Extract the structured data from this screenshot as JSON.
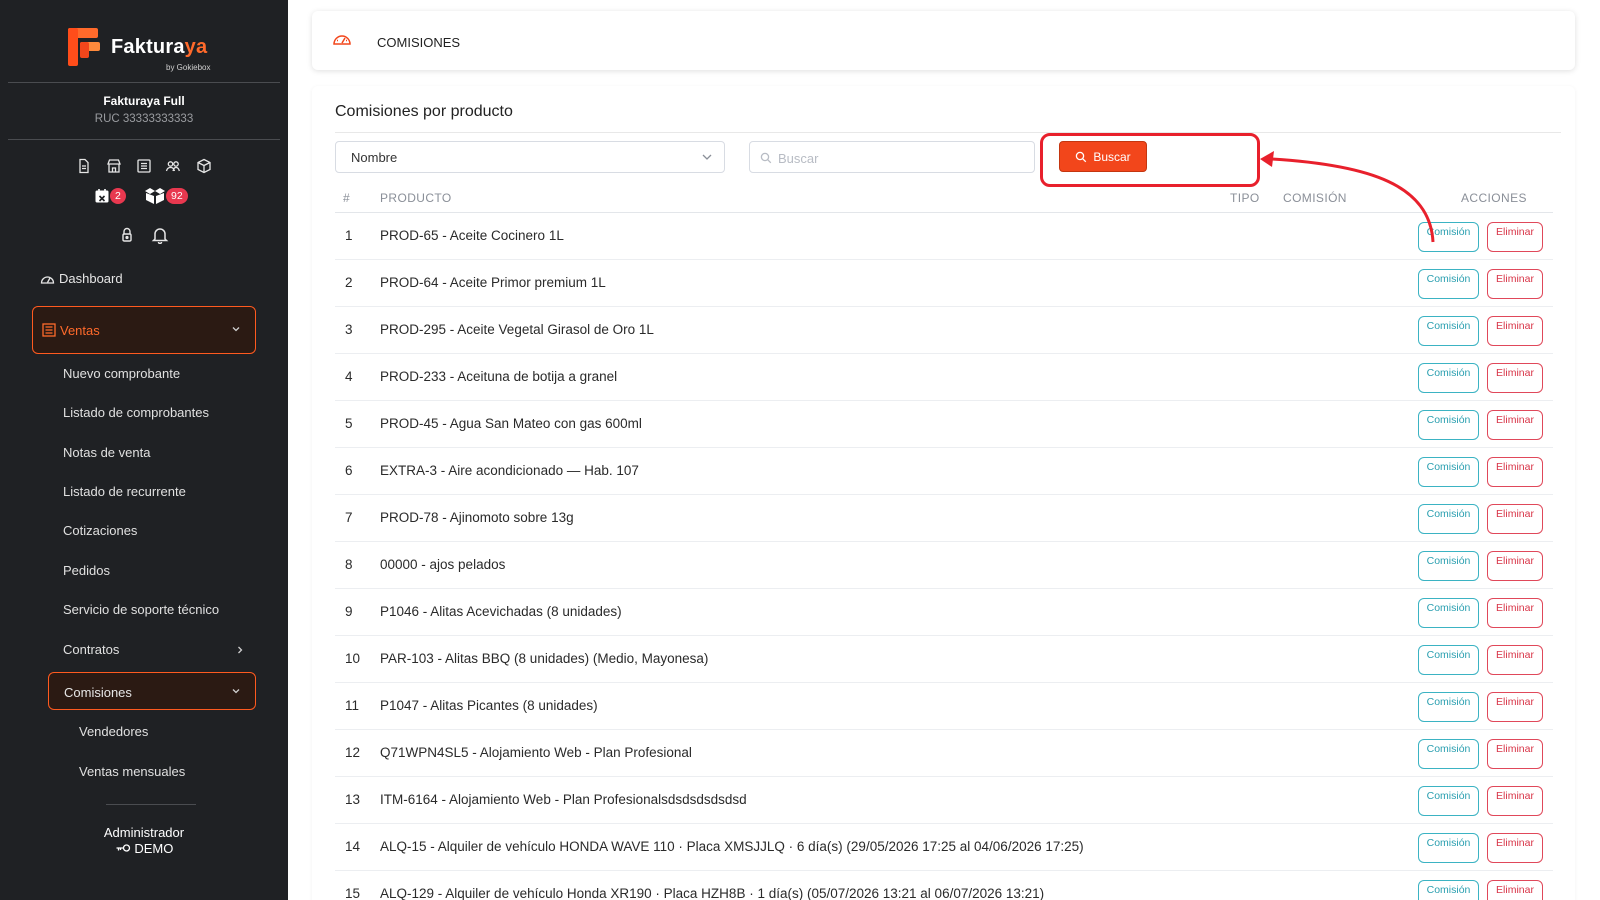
{
  "sidebar": {
    "brand": "Fakturaya",
    "brand_suffix": "by Gokiebox",
    "company_name": "Fakturaya Full",
    "company_ruc": "RUC 33333333333",
    "badges": {
      "calendar": "2",
      "boxes": "92"
    },
    "dashboard_label": "Dashboard",
    "ventas_label": "Ventas",
    "ventas_items": [
      "Nuevo comprobante",
      "Listado de comprobantes",
      "Notas de venta",
      "Listado de recurrente",
      "Cotizaciones",
      "Pedidos",
      "Servicio de soporte técnico",
      "Contratos"
    ],
    "comisiones_label": "Comisiones",
    "comisiones_items": [
      "Vendedores",
      "Ventas mensuales"
    ],
    "user_role": "Administrador",
    "user_name": "DEMO",
    "accent": "#ff5a1f"
  },
  "topbar": {
    "title": "COMISIONES"
  },
  "card": {
    "title": "Comisiones por producto",
    "filter_select": "Nombre",
    "search_placeholder": "Buscar",
    "search_button": "Buscar"
  },
  "table": {
    "headers": {
      "num": "#",
      "product": "PRODUCTO",
      "type": "TIPO",
      "commission": "COMISIÓN",
      "actions": "ACCIONES"
    },
    "action_commission": "Comisión",
    "action_delete": "Eliminar",
    "rows": [
      {
        "n": "1",
        "product": "PROD-65 - Aceite Cocinero 1L"
      },
      {
        "n": "2",
        "product": "PROD-64 - Aceite Primor premium 1L"
      },
      {
        "n": "3",
        "product": "PROD-295 - Aceite Vegetal Girasol de Oro 1L"
      },
      {
        "n": "4",
        "product": "PROD-233 - Aceituna de botija a granel"
      },
      {
        "n": "5",
        "product": "PROD-45 - Agua San Mateo con gas 600ml"
      },
      {
        "n": "6",
        "product": "EXTRA-3 - Aire acondicionado — Hab. 107"
      },
      {
        "n": "7",
        "product": "PROD-78 - Ajinomoto sobre 13g"
      },
      {
        "n": "8",
        "product": "00000 - ajos pelados"
      },
      {
        "n": "9",
        "product": "P1046 - Alitas Acevichadas (8 unidades)"
      },
      {
        "n": "10",
        "product": "PAR-103 - Alitas BBQ (8 unidades) (Medio, Mayonesa)"
      },
      {
        "n": "11",
        "product": "P1047 - Alitas Picantes (8 unidades)"
      },
      {
        "n": "12",
        "product": "Q71WPN4SL5 - Alojamiento Web - Plan Profesional"
      },
      {
        "n": "13",
        "product": "ITM-6164 - Alojamiento Web - Plan Profesionalsdsdsdsdsdsd"
      },
      {
        "n": "14",
        "product": "ALQ-15 - Alquiler de vehículo HONDA WAVE 110 · Placa XMSJJLQ · 6 día(s) (29/05/2026 17:25 al 04/06/2026 17:25)"
      },
      {
        "n": "15",
        "product": "ALQ-129 - Alquiler de vehículo Honda XR190 · Placa HZH8B · 1 día(s) (05/07/2026 13:21 al 06/07/2026 13:21)"
      }
    ]
  }
}
